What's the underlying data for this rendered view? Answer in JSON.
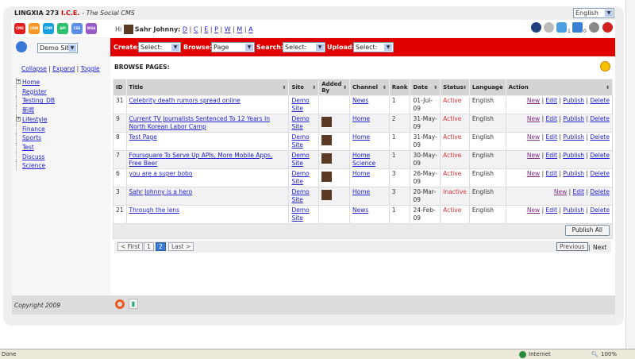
{
  "header": {
    "brand": "LINGXIA 273",
    "ice": "I.C.E.",
    "tagline": "- The Social CMS",
    "language": "English"
  },
  "apps": [
    {
      "label": "CMS",
      "color": "#e02020"
    },
    {
      "label": "CRM",
      "color": "#f59a2a"
    },
    {
      "label": "CPM",
      "color": "#1aa0e0"
    },
    {
      "label": "API",
      "color": "#2bbf6e"
    },
    {
      "label": "CSS",
      "color": "#5a8ee8"
    },
    {
      "label": "WSA",
      "color": "#9a5ac8"
    }
  ],
  "user": {
    "greeting": "Hi",
    "name": "Sahr Johnny:",
    "links": [
      "D",
      "C",
      "E",
      "P",
      "W",
      "M",
      "A"
    ]
  },
  "tools": {
    "sync_count": "1",
    "queue_count": "0"
  },
  "site_select": "Demo Site",
  "toolbar": {
    "create_label": "Create:",
    "create_value": "Select:",
    "browse_label": "Browse:",
    "browse_value": "Page",
    "search_label": "Search:",
    "search_value": "Select:",
    "upload_label": "Upload:",
    "upload_value": "Select:"
  },
  "tree_controls": {
    "collapse": "Collapse",
    "expand": "Expand",
    "toggle": "Toggle"
  },
  "tree": [
    "Home",
    "Register",
    "Testing_DB",
    "新闻",
    "Lifestyle",
    "Finance",
    "Sports",
    "Test",
    "Discuss",
    "Science"
  ],
  "page_heading": "BROWSE PAGES:",
  "table": {
    "headers": [
      "ID",
      "Title",
      "Site",
      "Added By",
      "Channel",
      "Rank",
      "Date",
      "Status",
      "Language",
      "Action"
    ],
    "rows": [
      {
        "id": "31",
        "title": "Celebrity death rumors spread online",
        "site": "Demo Site",
        "avatar": false,
        "channel": "News",
        "rank": "1",
        "date": "01-Jul-09",
        "status": "Active",
        "language": "English",
        "actions": [
          "New",
          "Edit",
          "Publish",
          "Delete"
        ]
      },
      {
        "id": "9",
        "title": "Current TV Journalists Sentenced To 12 Years In North Korean Labor Camp",
        "site": "Demo Site",
        "avatar": true,
        "channel": "Home",
        "rank": "2",
        "date": "31-May-09",
        "status": "Active",
        "language": "English",
        "actions": [
          "New",
          "Edit",
          "Publish",
          "Delete"
        ]
      },
      {
        "id": "8",
        "title": "Test Page",
        "site": "Demo Site",
        "avatar": true,
        "channel": "Home",
        "rank": "1",
        "date": "31-May-09",
        "status": "Active",
        "language": "English",
        "actions": [
          "New",
          "Edit",
          "Publish",
          "Delete"
        ]
      },
      {
        "id": "7",
        "title": "Foursquare To Serve Up APIs, More Mobile Apps, Free Beer",
        "site": "Demo Site",
        "avatar": true,
        "channel": "Home Science",
        "rank": "1",
        "date": "30-May-09",
        "status": "Active",
        "language": "English",
        "actions": [
          "New",
          "Edit",
          "Publish",
          "Delete"
        ]
      },
      {
        "id": "6",
        "title": "you are a super bobo",
        "site": "Demo Site",
        "avatar": true,
        "channel": "Home",
        "rank": "3",
        "date": "26-May-09",
        "status": "Active",
        "language": "English",
        "actions": [
          "New",
          "Edit",
          "Publish",
          "Delete"
        ]
      },
      {
        "id": "3",
        "title": "Sahr Johnny is a hero",
        "site": "Demo Site",
        "avatar": true,
        "channel": "Home",
        "rank": "3",
        "date": "20-Mar-09",
        "status": "Inactive",
        "language": "English",
        "actions": [
          "New",
          "Edit",
          "Delete"
        ]
      },
      {
        "id": "21",
        "title": "Through the lens",
        "site": "Demo Site",
        "avatar": false,
        "channel": "News",
        "rank": "1",
        "date": "24-Feb-09",
        "status": "Active",
        "language": "English",
        "actions": [
          "New",
          "Edit",
          "Publish",
          "Delete"
        ]
      }
    ],
    "publish_all": "Publish All"
  },
  "pagination": {
    "first": "< First",
    "pages": [
      "1",
      "2"
    ],
    "current": "2",
    "last": "Last >",
    "previous": "Previous",
    "sep": "|",
    "next": "Next"
  },
  "footer": {
    "copyright": "Copyright 2009"
  },
  "statusbar": {
    "status": "Done",
    "zone": "Internet",
    "zoom": "100%"
  }
}
